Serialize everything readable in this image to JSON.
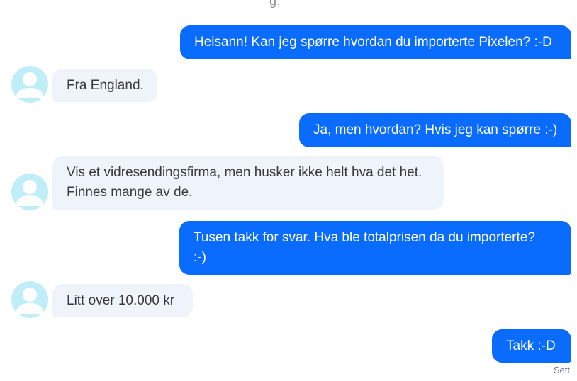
{
  "chat": {
    "top_fragment": "g,",
    "messages": [
      {
        "id": "m1",
        "direction": "outgoing",
        "text": "Heisann! Kan jeg spørre hvordan du importerte Pixelen? :-D"
      },
      {
        "id": "m2",
        "direction": "incoming",
        "text": "Fra England."
      },
      {
        "id": "m3",
        "direction": "outgoing",
        "text": "Ja, men hvordan? Hvis jeg kan spørre :-)"
      },
      {
        "id": "m4",
        "direction": "incoming",
        "lines": [
          "Vis et vidresendingsfirma, men husker ikke helt hva det het.",
          "Finnes mange av de."
        ]
      },
      {
        "id": "m5",
        "direction": "outgoing",
        "lines": [
          "Tusen takk for svar. Hva ble totalprisen da du importerte?",
          ":-)"
        ]
      },
      {
        "id": "m6",
        "direction": "incoming",
        "text": "Litt over 10.000 kr"
      },
      {
        "id": "m7",
        "direction": "outgoing",
        "text": "Takk :-D"
      }
    ],
    "status": "Sett"
  },
  "colors": {
    "outgoing_bubble": "#0a6cff",
    "incoming_bubble": "#eef4fa",
    "avatar_bg": "#bfeef8",
    "avatar_fg": "#ffffff"
  },
  "icons": {
    "avatar": "user-avatar-icon"
  }
}
